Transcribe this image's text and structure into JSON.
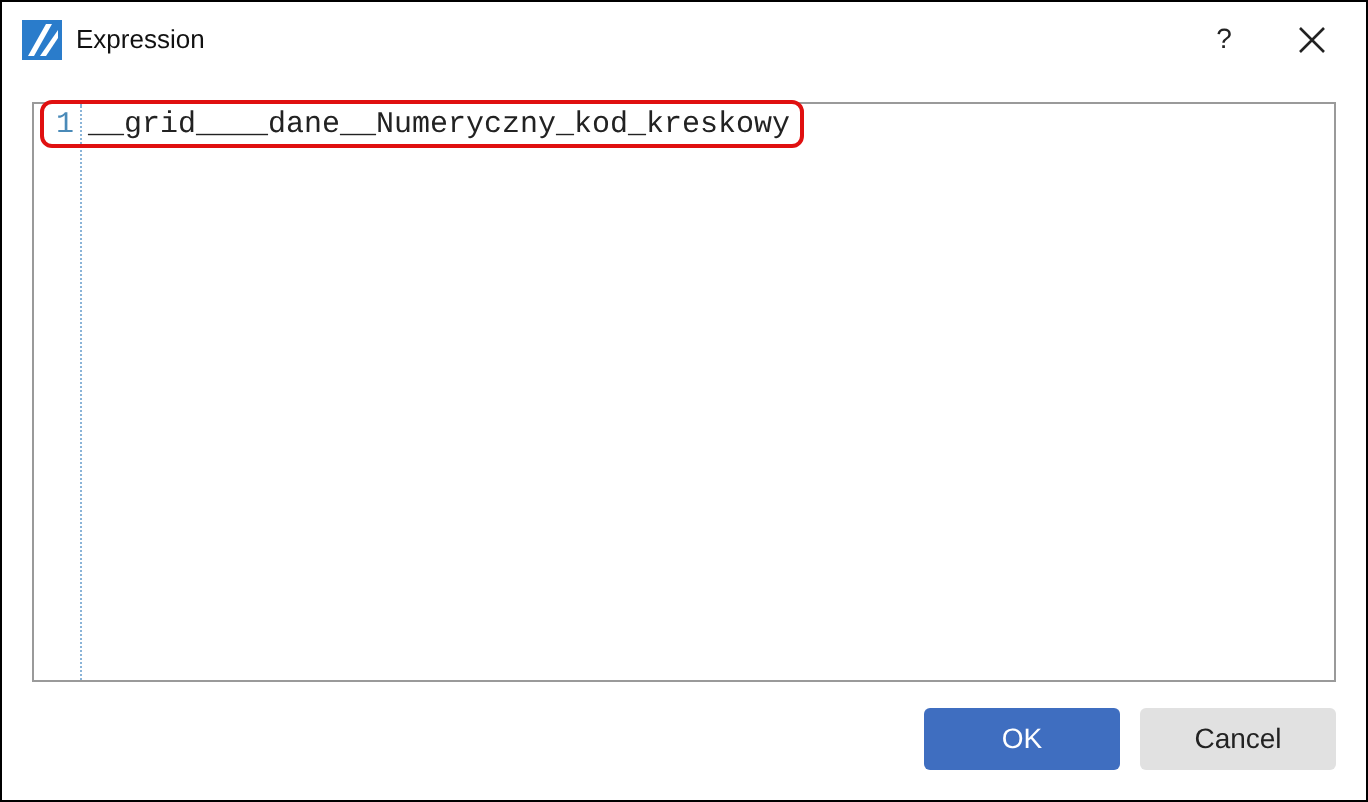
{
  "window": {
    "title": "Expression",
    "help_button": "?"
  },
  "editor": {
    "lines": [
      {
        "number": "1",
        "text": "__grid____dane__Numeryczny_kod_kreskowy",
        "highlighted": true
      }
    ]
  },
  "buttons": [
    {
      "label": "OK",
      "kind": "primary"
    },
    {
      "label": "Cancel",
      "kind": "secondary"
    }
  ]
}
